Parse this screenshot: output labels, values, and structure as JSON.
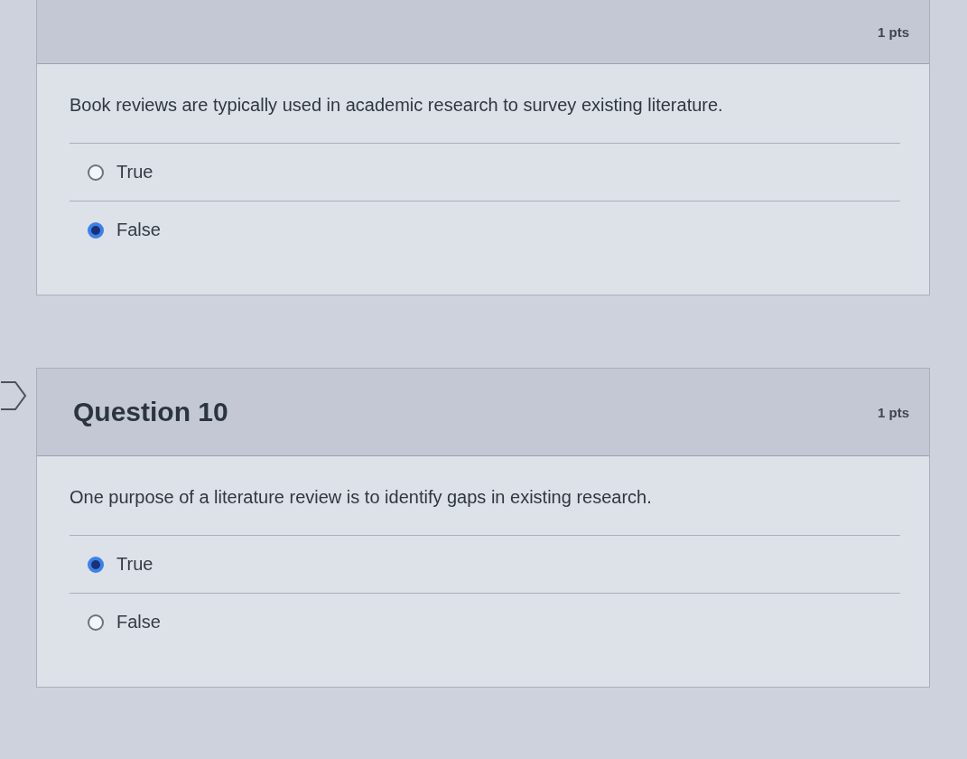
{
  "questions": [
    {
      "points": "1 pts",
      "text": "Book reviews are typically used in academic research to survey existing literature.",
      "answers": [
        {
          "label": "True",
          "selected": false
        },
        {
          "label": "False",
          "selected": true
        }
      ]
    },
    {
      "title": "Question 10",
      "points": "1 pts",
      "text": "One purpose of a literature review is to identify gaps in existing research.",
      "answers": [
        {
          "label": "True",
          "selected": true
        },
        {
          "label": "False",
          "selected": false
        }
      ]
    }
  ]
}
